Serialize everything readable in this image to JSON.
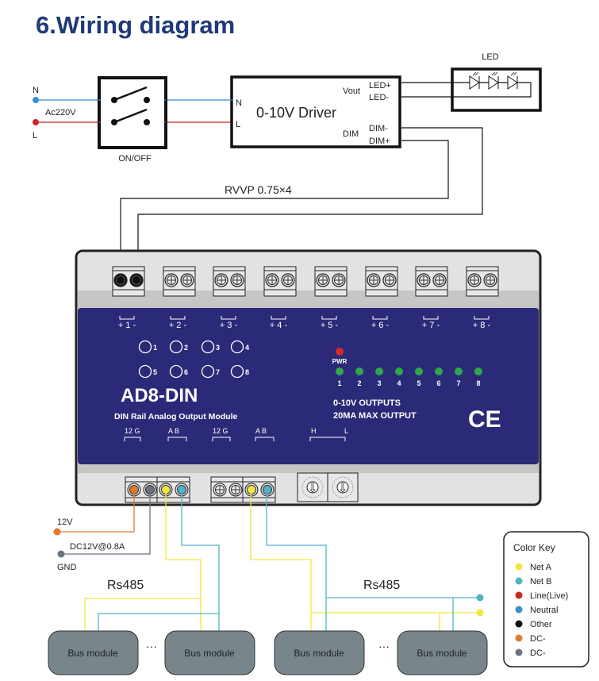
{
  "title": "6.Wiring diagram",
  "power_input": {
    "n_label": "N",
    "l_label": "L",
    "voltage": "Ac220V"
  },
  "switch": {
    "label": "ON/OFF"
  },
  "driver": {
    "name": "0-10V Driver",
    "n": "N",
    "l": "L",
    "vout": "Vout",
    "led_plus": "LED+",
    "led_minus": "LED-",
    "dim": "DIM",
    "dim_minus": "DIM-",
    "dim_plus": "DIM+"
  },
  "led": {
    "label": "LED"
  },
  "cable": {
    "label": "RVVP 0.75×4"
  },
  "module": {
    "name": "AD8-DIN",
    "subtitle": "DIN Rail Analog Output Module",
    "outputs_line1": "0-10V OUTPUTS",
    "outputs_line2": "20MA MAX OUTPUT",
    "ce_mark": "CE",
    "pwr_label": "PWR",
    "channel_labels": [
      "+ 1 -",
      "+ 2 -",
      "+ 3 -",
      "+ 4 -",
      "+ 5 -",
      "+ 6 -",
      "+ 7 -",
      "+ 8 -"
    ],
    "button_labels": [
      "1",
      "2",
      "3",
      "4",
      "5",
      "6",
      "7",
      "8"
    ],
    "indicator_labels": [
      "1",
      "2",
      "3",
      "4",
      "5",
      "6",
      "7",
      "8"
    ],
    "bottom_labels": [
      "12  G",
      "A   B",
      "12  G",
      "A   B",
      "H",
      "L"
    ]
  },
  "power_supply": {
    "v12": "12V",
    "rating": "DC12V@0.8A",
    "gnd": "GND"
  },
  "bus": {
    "rs485_left": "Rs485",
    "rs485_right": "Rs485",
    "module_label": "Bus module",
    "ellipsis": "···"
  },
  "color_key": {
    "title": "Color Key",
    "items": [
      {
        "label": "Net A",
        "color": "#f3e640"
      },
      {
        "label": "Net B",
        "color": "#4fb5c6"
      },
      {
        "label": "Line(Live)",
        "color": "#c62828"
      },
      {
        "label": "Neutral",
        "color": "#3a8fd0"
      },
      {
        "label": "Other",
        "color": "#111111"
      },
      {
        "label": "DC-",
        "color": "#e07a2a"
      },
      {
        "label": "DC-",
        "color": "#6b7380"
      }
    ]
  },
  "colors": {
    "title": "#1f3a78",
    "panel": "#2b2a78",
    "netA": "#f3e640",
    "netB": "#4fb5c6",
    "live": "#c62828",
    "neutral": "#3a8fd0",
    "dc_pos": "#e07a2a",
    "dc_neg": "#6b7380",
    "led_green": "#2fa84a",
    "led_red": "#d42a2a",
    "bus_module": "#78868c"
  }
}
